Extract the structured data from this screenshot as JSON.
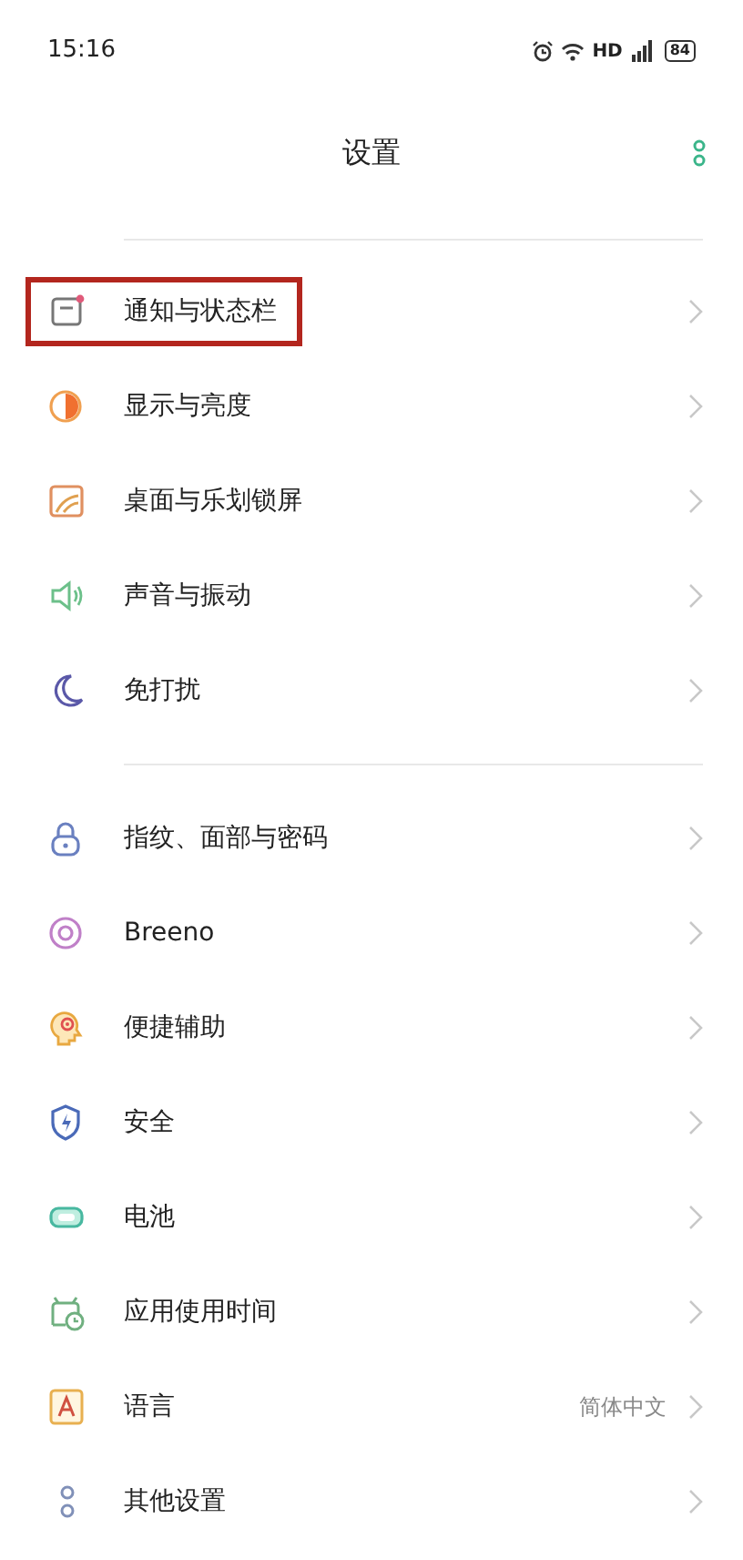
{
  "status_bar": {
    "time": "15:16",
    "network": "HD",
    "battery": "84"
  },
  "header": {
    "title": "设置"
  },
  "groups": [
    {
      "items": [
        {
          "label": "通知与状态栏",
          "highlighted": true
        },
        {
          "label": "显示与亮度",
          "highlighted": false
        },
        {
          "label": "桌面与乐划锁屏",
          "highlighted": false
        },
        {
          "label": "声音与振动",
          "highlighted": false
        },
        {
          "label": "免打扰",
          "highlighted": false
        }
      ]
    },
    {
      "items": [
        {
          "label": "指纹、面部与密码",
          "highlighted": false
        },
        {
          "label": "Breeno",
          "highlighted": false
        },
        {
          "label": "便捷辅助",
          "highlighted": false
        },
        {
          "label": "安全",
          "highlighted": false
        },
        {
          "label": "电池",
          "highlighted": false
        },
        {
          "label": "应用使用时间",
          "highlighted": false
        },
        {
          "label": "语言",
          "value": "简体中文",
          "highlighted": false
        },
        {
          "label": "其他设置",
          "highlighted": false
        }
      ]
    }
  ]
}
